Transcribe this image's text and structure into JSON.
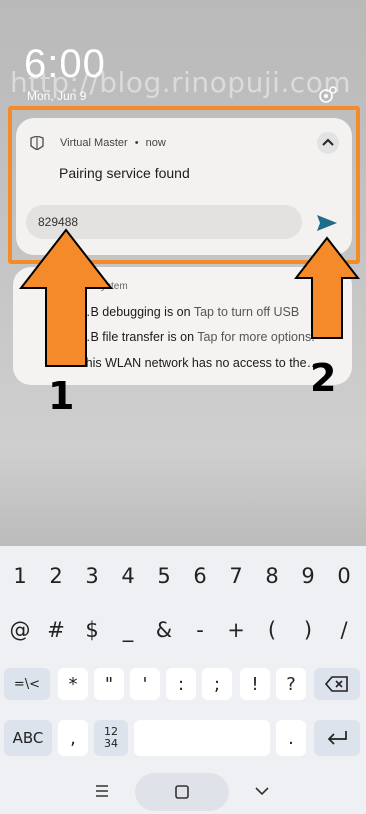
{
  "lockscreen": {
    "time": "6:00",
    "date": "Mon, Jun 9",
    "watermark": "http://blog.rinopuji.com"
  },
  "notification_pairing": {
    "app_name": "Virtual Master",
    "separator": "•",
    "when": "now",
    "title": "Pairing service found",
    "reply_value": "829488",
    "reply_placeholder": ""
  },
  "notification_system": {
    "app_label": "…d System",
    "rows": [
      {
        "bold": "…B debugging is on",
        "rest": " Tap to turn off USB"
      },
      {
        "bold": "…B file transfer is on",
        "rest": " Tap for more options."
      },
      {
        "bold": "This WLAN network has no access to the…",
        "rest": ""
      }
    ]
  },
  "annotations": {
    "label_1": "1",
    "label_2": "2",
    "arrow_color": "#f58a2a"
  },
  "keyboard": {
    "number_row": [
      "1",
      "2",
      "3",
      "4",
      "5",
      "6",
      "7",
      "8",
      "9",
      "0"
    ],
    "symbols_row1": [
      "@",
      "#",
      "$",
      "_",
      "&",
      "-",
      "+",
      "(",
      ")",
      "/"
    ],
    "symbols_row2": [
      "=\\<",
      "*",
      "\"",
      "'",
      ":",
      ";",
      "!",
      "?"
    ],
    "bottom_row": {
      "abc": "ABC",
      "comma": ",",
      "numpad_top": "12",
      "numpad_bottom": "34",
      "period": "."
    }
  },
  "colors": {
    "accent": "#f58a2a",
    "send": "#1f6d8b"
  }
}
